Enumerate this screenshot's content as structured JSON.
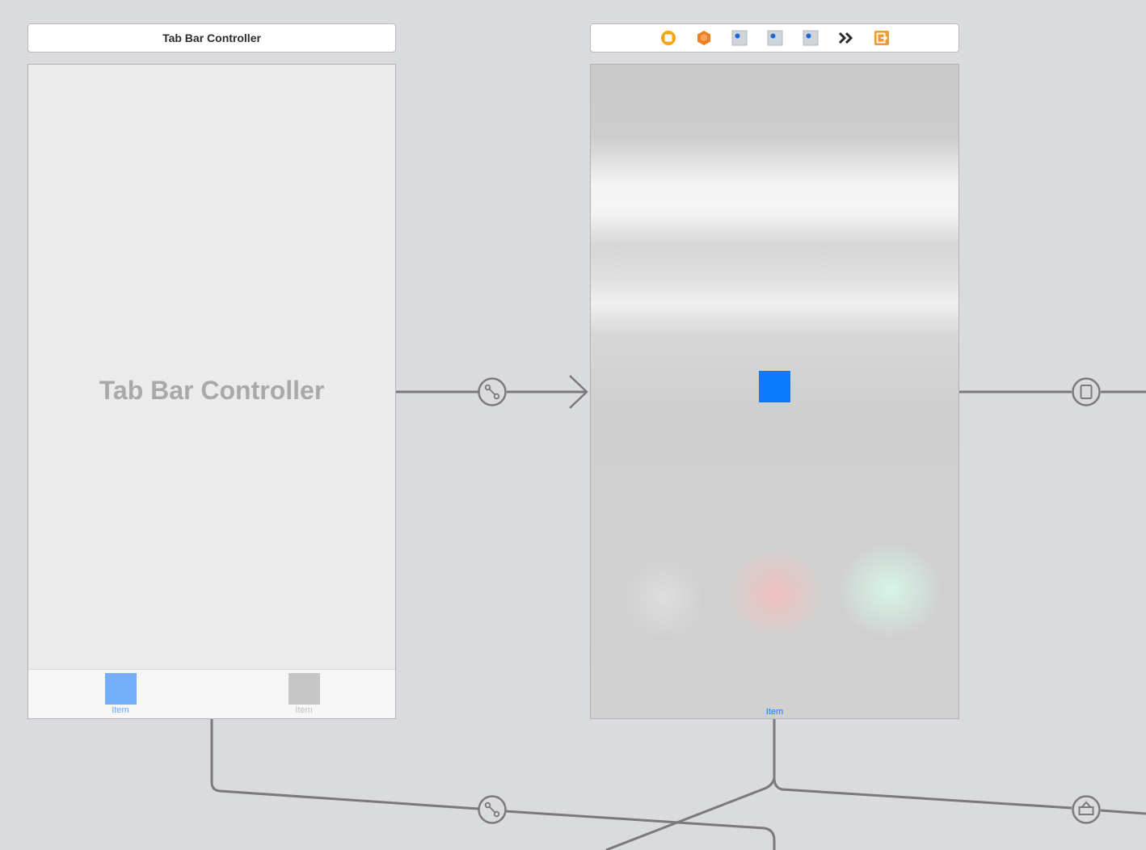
{
  "tab_bar_controller": {
    "title": "Tab Bar Controller",
    "placeholder_label": "Tab Bar Controller",
    "tabs": [
      {
        "label": "Item",
        "color": "#74adf8",
        "label_color": "#6aa8f7"
      },
      {
        "label": "Item",
        "color": "#c6c6c6",
        "label_color": "#c2c2c2"
      }
    ]
  },
  "view_controller": {
    "dock_icons": [
      "view-controller-icon",
      "first-responder-icon",
      "outlet-object-icon-1",
      "outlet-object-icon-2",
      "outlet-object-icon-3",
      "more-objects-icon",
      "exit-icon"
    ],
    "tab_item_label": "Item",
    "accent_color": "#0a7bff"
  },
  "segues": [
    {
      "name": "relationship-segue-to-view-controller",
      "icon": "relationship-segue-icon"
    },
    {
      "name": "relationship-segue-second-tab",
      "icon": "relationship-segue-icon"
    },
    {
      "name": "show-segue",
      "icon": "show-segue-icon"
    },
    {
      "name": "present-modally-segue",
      "icon": "present-modally-segue-icon"
    }
  ],
  "colors": {
    "canvas": "#dadbdf",
    "connector": "#7a7a7c",
    "dock_orange": "#f2993a",
    "dock_yellow": "#f6a511"
  }
}
